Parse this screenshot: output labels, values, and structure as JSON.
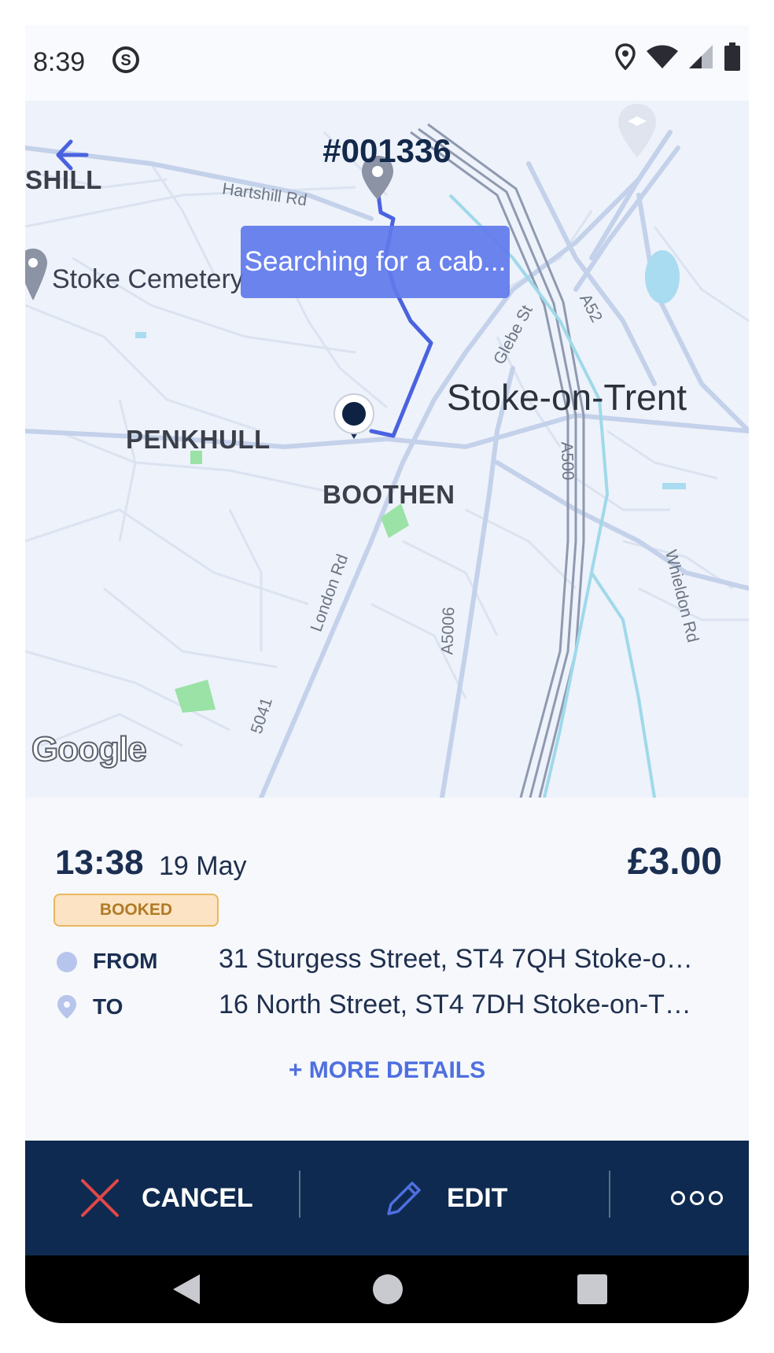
{
  "status_bar": {
    "time": "8:39",
    "icons": [
      "s-app-icon",
      "location-icon",
      "wifi-icon",
      "signal-icon",
      "battery-icon"
    ]
  },
  "header": {
    "order_number": "#001336",
    "back_icon": "back-arrow-icon"
  },
  "map": {
    "search_status": "Searching for a cab...",
    "labels": {
      "shill": "SHILL",
      "hartshill_rd": "Hartshill Rd",
      "stoke_cemetery": "Stoke Cemetery",
      "glebe_st": "Glebe St",
      "a52": "A52",
      "stoke_on_trent": "Stoke-on-Trent",
      "penkhull": "PENKHULL",
      "boothen": "BOOTHEN",
      "a500": "A500",
      "london_rd": "London Rd",
      "a5006": "A5006",
      "whieldon_rd": "Whieldon Rd",
      "a5041": "5041",
      "google": "Google"
    }
  },
  "booking": {
    "time": "13:38",
    "date": "19 May",
    "fare": "£3.00",
    "status": "BOOKED",
    "from_label": "FROM",
    "from_address": "31 Sturgess Street, ST4 7QH Stoke-o…",
    "to_label": "TO",
    "to_address": "16 North Street, ST4 7DH Stoke-on-T…",
    "more_details": "+ MORE DETAILS"
  },
  "actions": {
    "cancel": "CANCEL",
    "edit": "EDIT",
    "more_icon": "more-options-icon"
  },
  "colors": {
    "navy": "#0e2a50",
    "accent_blue": "#4f6fe0",
    "route_blue": "#4a62e0",
    "cancel_red": "#e04848",
    "badge_bg": "#fbe3c3",
    "badge_text": "#b07b27"
  }
}
